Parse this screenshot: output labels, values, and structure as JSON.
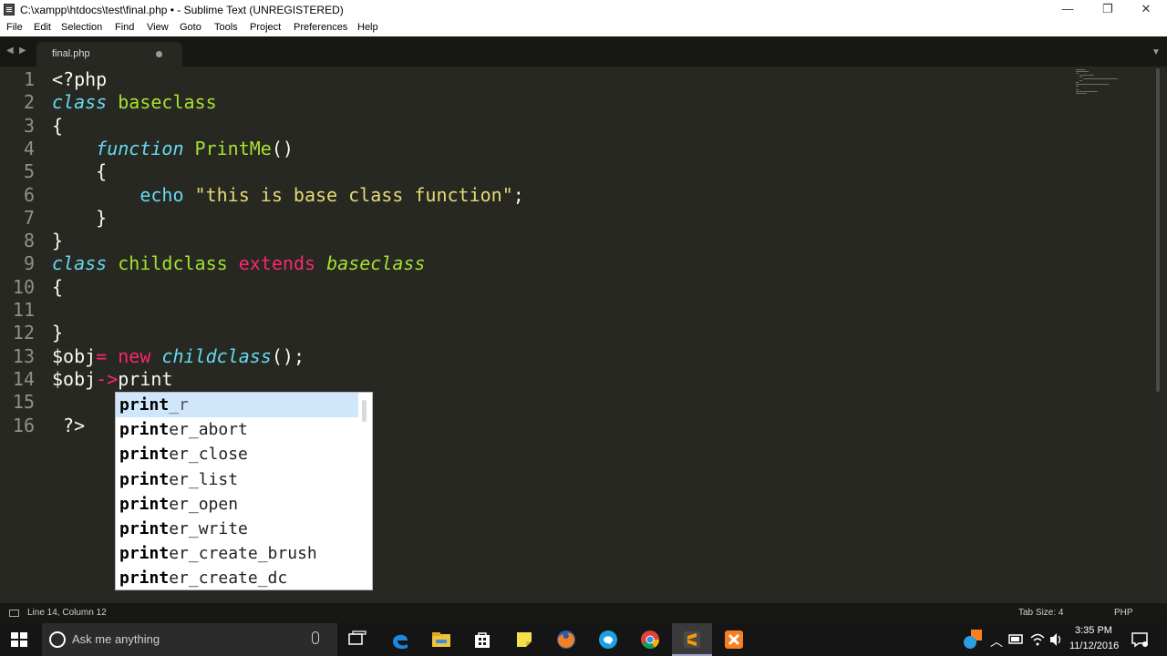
{
  "window": {
    "title": "C:\\xampp\\htdocs\\test\\final.php • - Sublime Text (UNREGISTERED)",
    "minimize_glyph": "—",
    "maximize_glyph": "❐",
    "close_glyph": "✕"
  },
  "menu": [
    "File",
    "Edit",
    "Selection",
    "Find",
    "View",
    "Goto",
    "Tools",
    "Project",
    "Preferences",
    "Help"
  ],
  "tabs": {
    "active": {
      "label": "final.php",
      "modified_indicator": "dot"
    },
    "nav_left": "◀",
    "nav_right": "▶",
    "dropdown": "▼"
  },
  "editor": {
    "line_numbers": [
      "1",
      "2",
      "3",
      "4",
      "5",
      "6",
      "7",
      "8",
      "9",
      "10",
      "11",
      "12",
      "13",
      "14",
      "15",
      "16"
    ],
    "colors": {
      "background": "#272822",
      "keyword": "#66d9ef",
      "name": "#a6e22e",
      "operator": "#f92672",
      "string": "#e6db74",
      "text": "#f8f8f2"
    },
    "lines": [
      [
        {
          "t": "<?php",
          "c": "k-white"
        }
      ],
      [
        {
          "t": "class",
          "c": "k-italic-blue"
        },
        {
          "t": " "
        },
        {
          "t": "baseclass",
          "c": "k-green"
        }
      ],
      [
        {
          "t": "{",
          "c": "k-white"
        }
      ],
      [
        {
          "t": "    "
        },
        {
          "t": "function",
          "c": "k-italic-blue"
        },
        {
          "t": " "
        },
        {
          "t": "PrintMe",
          "c": "k-green"
        },
        {
          "t": "()",
          "c": "k-white"
        }
      ],
      [
        {
          "t": "    {",
          "c": "k-white"
        }
      ],
      [
        {
          "t": "        "
        },
        {
          "t": "echo",
          "c": "k-blue"
        },
        {
          "t": " "
        },
        {
          "t": "\"this is base class function\"",
          "c": "k-yellow"
        },
        {
          "t": ";",
          "c": "k-white"
        }
      ],
      [
        {
          "t": "    }",
          "c": "k-white"
        }
      ],
      [
        {
          "t": "}",
          "c": "k-white"
        }
      ],
      [
        {
          "t": "class",
          "c": "k-italic-blue"
        },
        {
          "t": " "
        },
        {
          "t": "childclass",
          "c": "k-green"
        },
        {
          "t": " "
        },
        {
          "t": "extends",
          "c": "k-pink"
        },
        {
          "t": " "
        },
        {
          "t": "baseclass",
          "c": "k-green-italic"
        }
      ],
      [
        {
          "t": "{",
          "c": "k-white"
        }
      ],
      [
        {
          "t": ""
        }
      ],
      [
        {
          "t": "}",
          "c": "k-white"
        }
      ],
      [
        {
          "t": "$obj",
          "c": "k-white"
        },
        {
          "t": "=",
          "c": "k-pink"
        },
        {
          "t": " "
        },
        {
          "t": "new",
          "c": "k-pink"
        },
        {
          "t": " "
        },
        {
          "t": "childclass",
          "c": "k-italic-blue"
        },
        {
          "t": "();",
          "c": "k-white"
        }
      ],
      [
        {
          "t": "$obj",
          "c": "k-white"
        },
        {
          "t": "->",
          "c": "k-pink"
        },
        {
          "t": "print",
          "c": "k-white"
        }
      ],
      [
        {
          "t": ""
        }
      ],
      [
        {
          "t": " ?>",
          "c": "k-white"
        }
      ]
    ]
  },
  "autocomplete": {
    "typed": "print",
    "items": [
      {
        "match": "print",
        "rest": "_r",
        "selected": true
      },
      {
        "match": "print",
        "rest": "er_abort"
      },
      {
        "match": "print",
        "rest": "er_close"
      },
      {
        "match": "print",
        "rest": "er_list"
      },
      {
        "match": "print",
        "rest": "er_open"
      },
      {
        "match": "print",
        "rest": "er_write"
      },
      {
        "match": "print",
        "rest": "er_create_brush"
      },
      {
        "match": "print",
        "rest": "er_create_dc"
      }
    ]
  },
  "status": {
    "position": "Line 14, Column 12",
    "tab_size": "Tab Size: 4",
    "syntax": "PHP"
  },
  "taskbar": {
    "search_placeholder": "Ask me anything",
    "time": "3:35 PM",
    "date": "11/12/2016",
    "icons": [
      "start-icon",
      "search-icon",
      "microphone-icon",
      "task-view-icon",
      "edge-icon",
      "file-explorer-icon",
      "store-icon",
      "sticky-notes-icon",
      "firefox-icon",
      "messaging-icon",
      "chrome-icon",
      "sublime-text-icon",
      "xampp-icon"
    ],
    "tray_icons": [
      "xampp-tray-icon",
      "chevron-up-icon",
      "battery-icon",
      "wifi-icon",
      "volume-icon",
      "notifications-icon"
    ]
  }
}
